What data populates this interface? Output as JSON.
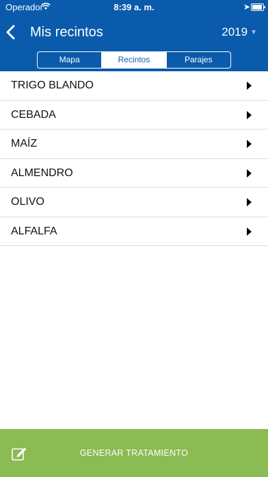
{
  "status_bar": {
    "carrier": "Operador",
    "time": "8:39 a. m."
  },
  "header": {
    "title": "Mis recintos",
    "year": "2019"
  },
  "tabs": [
    {
      "label": "Mapa",
      "active": false
    },
    {
      "label": "Recintos",
      "active": true
    },
    {
      "label": "Parajes",
      "active": false
    }
  ],
  "list": {
    "items": [
      {
        "label": "TRIGO BLANDO"
      },
      {
        "label": "CEBADA"
      },
      {
        "label": "MAÍZ"
      },
      {
        "label": "ALMENDRO"
      },
      {
        "label": "OLIVO"
      },
      {
        "label": "ALFALFA"
      }
    ]
  },
  "footer": {
    "button_label": "GENERAR TRATAMIENTO"
  },
  "colors": {
    "header_bg": "#0a5bab",
    "footer_bg": "#8bbb53"
  },
  "icons": {
    "back": "chevron-left-icon",
    "year_dropdown": "caret-down-icon",
    "row_disclosure": "triangle-right-icon",
    "generate": "edit-icon"
  }
}
